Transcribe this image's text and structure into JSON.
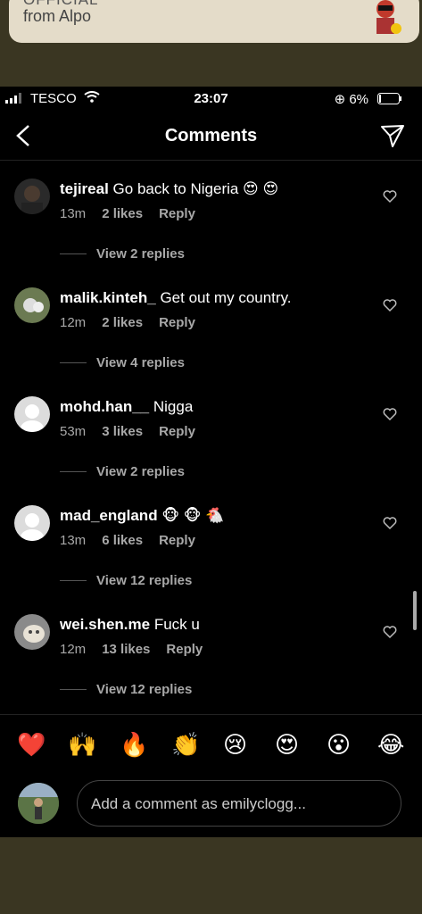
{
  "notification": {
    "title": "OFFICIAL",
    "subtitle": "from Alpo"
  },
  "status": {
    "carrier": "TESCO",
    "time": "23:07",
    "battery": "6%"
  },
  "header": {
    "title": "Comments"
  },
  "comments": [
    {
      "user": "tejireal",
      "text": "Go back to Nigeria 😍 😍",
      "time": "13m",
      "likes": "2 likes",
      "reply": "Reply",
      "replies": "View 2 replies"
    },
    {
      "user": "malik.kinteh_",
      "text": "Get out my country.",
      "time": "12m",
      "likes": "2 likes",
      "reply": "Reply",
      "replies": "View 4 replies"
    },
    {
      "user": "mohd.han__",
      "text": "Nigga",
      "time": "53m",
      "likes": "3 likes",
      "reply": "Reply",
      "replies": "View 2 replies"
    },
    {
      "user": "mad_england",
      "text": "🐵 🐵 🐔",
      "time": "13m",
      "likes": "6 likes",
      "reply": "Reply",
      "replies": "View 12 replies"
    },
    {
      "user": "wei.shen.me",
      "text": "Fuck u",
      "time": "12m",
      "likes": "13 likes",
      "reply": "Reply",
      "replies": "View 12 replies"
    }
  ],
  "emojis": [
    "❤️",
    "🙌",
    "🔥",
    "👏",
    "😢",
    "😍",
    "😮",
    "😂"
  ],
  "input": {
    "placeholder": "Add a comment as emilyclogg..."
  }
}
